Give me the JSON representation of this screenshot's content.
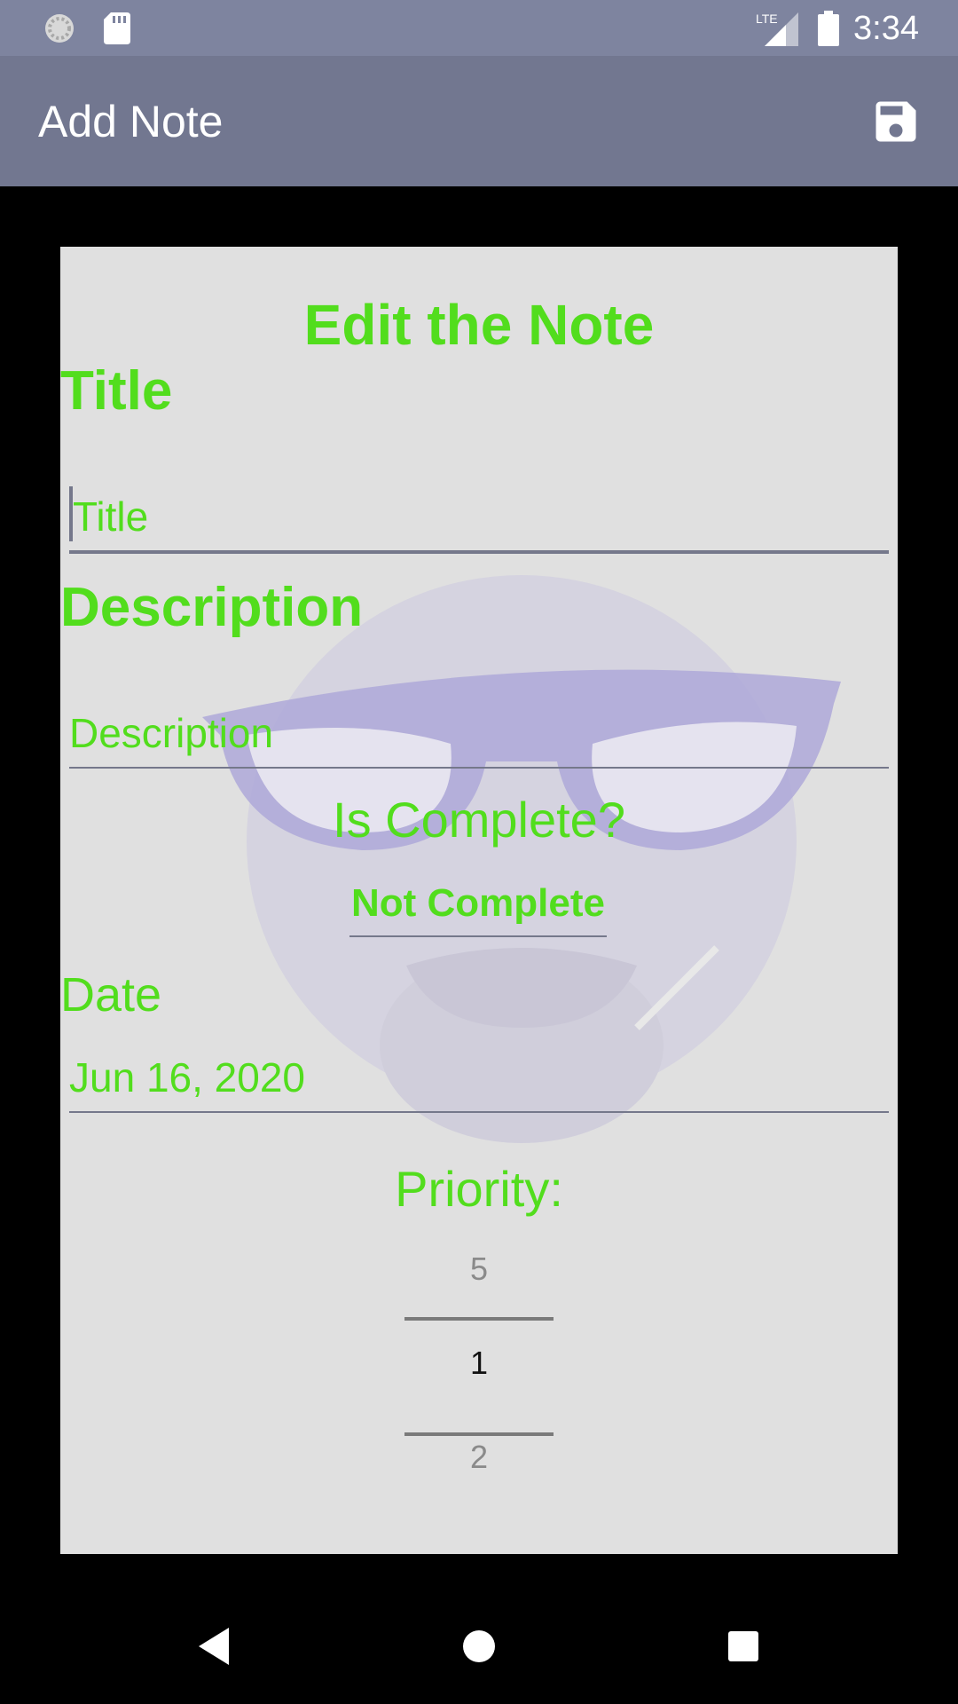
{
  "status_bar": {
    "time": "3:34",
    "network_label": "LTE",
    "icons": [
      "loading-icon",
      "sd-card-icon",
      "lte-signal-icon",
      "battery-icon"
    ]
  },
  "app_bar": {
    "title": "Add Note",
    "save_icon": "save-icon"
  },
  "form": {
    "heading": "Edit the Note",
    "title_label": "Title",
    "title_placeholder": "Title",
    "description_label": "Description",
    "description_placeholder": "Description",
    "complete_label": "Is Complete?",
    "complete_value": "Not Complete",
    "date_label": "Date",
    "date_value": "Jun 16, 2020",
    "priority_label": "Priority:",
    "priority_picker": {
      "previous": "5",
      "selected": "1",
      "next": "2"
    }
  },
  "nav_bar": {
    "icons": [
      "back-icon",
      "home-icon",
      "recents-icon"
    ]
  },
  "colors": {
    "accent_green": "#52dd1d",
    "status_bar": "#7e849f",
    "app_bar": "#727790",
    "card_bg": "#e0e0e0"
  }
}
